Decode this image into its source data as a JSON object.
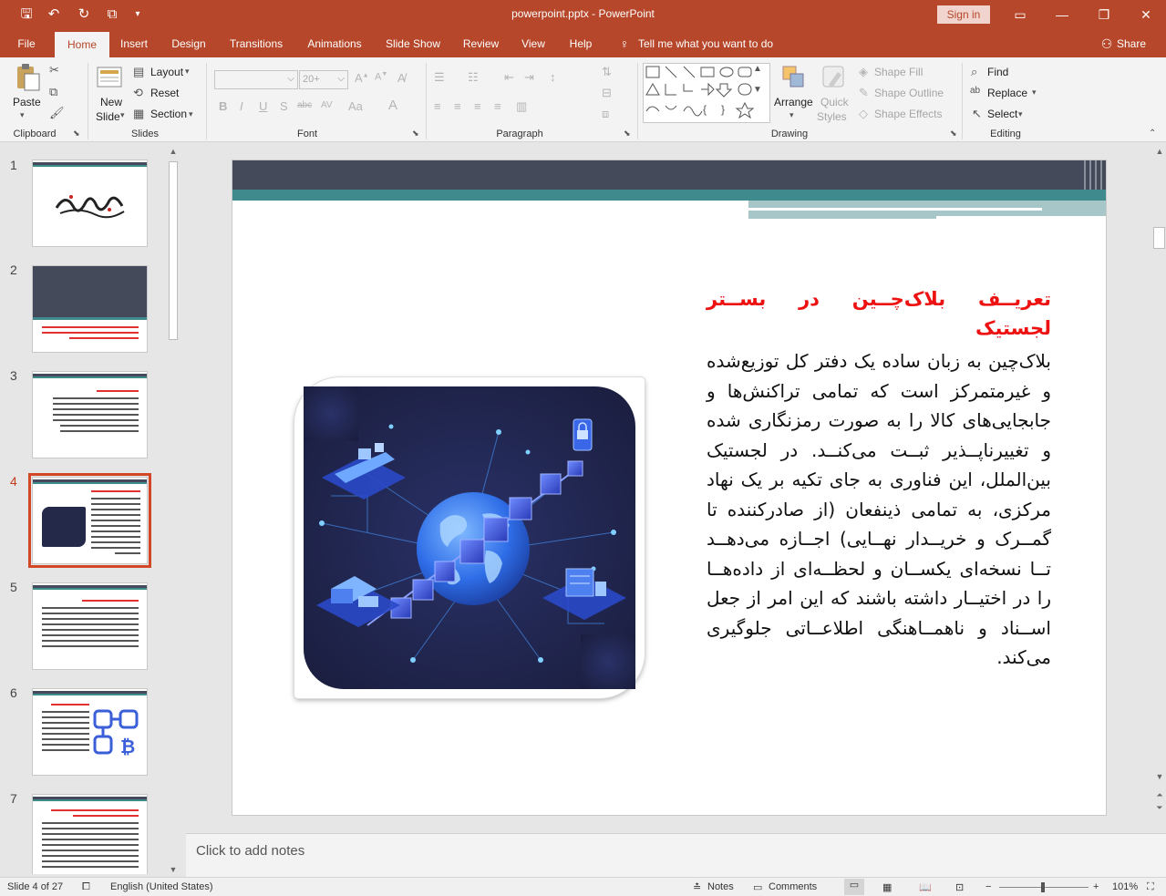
{
  "window": {
    "doc_title": "powerpoint.pptx  -  PowerPoint",
    "signin": "Sign in"
  },
  "tabs": [
    "File",
    "Home",
    "Insert",
    "Design",
    "Transitions",
    "Animations",
    "Slide Show",
    "Review",
    "View",
    "Help"
  ],
  "active_tab": "Home",
  "tell_me": "Tell me what you want to do",
  "share": "Share",
  "ribbon": {
    "clipboard": {
      "label": "Clipboard",
      "paste": "Paste"
    },
    "slides": {
      "label": "Slides",
      "new_slide_1": "New",
      "new_slide_2": "Slide",
      "layout": "Layout",
      "reset": "Reset",
      "section": "Section"
    },
    "font": {
      "label": "Font",
      "size_value": "20+"
    },
    "paragraph": {
      "label": "Paragraph"
    },
    "drawing": {
      "label": "Drawing",
      "arrange": "Arrange",
      "quick_styles_1": "Quick",
      "quick_styles_2": "Styles",
      "shape_fill": "Shape Fill",
      "shape_outline": "Shape Outline",
      "shape_effects": "Shape Effects"
    },
    "editing": {
      "label": "Editing",
      "find": "Find",
      "replace": "Replace",
      "select": "Select"
    }
  },
  "thumbnails": {
    "numbers": [
      "1",
      "2",
      "3",
      "4",
      "5",
      "6",
      "7"
    ],
    "current_index": 4
  },
  "slide": {
    "title": "تعریــف بلاک‌چــین در بســتر لجستیک",
    "body": "بلاک‌چین به زبان ساده یک دفتر کل توزیع‌شده و غیرمتمرکز است که تمامی تراکنش‌ها و جابجایی‌های کالا را به صورت رمزنگاری شده و تغییرناپــذیر ثبــت می‌کنــد. در لجستیک بین‌الملل، این فناوری به جای تکیه بر یک نهاد مرکزی، به تمامی ذینفعان (از صادرکننده تا گمــرک و خریــدار نهــایی) اجــازه می‌دهــد تــا نسخه‌ای یکســان و لحظــه‌ای از داده‌هــا را در اختیــار داشته باشند که این امر از جعل اســناد و ناهمــاهنگی اطلاعــاتی جلوگیری می‌کند."
  },
  "notes_placeholder": "Click to add notes",
  "status": {
    "slide_of": "Slide 4 of 27",
    "language": "English (United States)",
    "notes": "Notes",
    "comments": "Comments",
    "zoom": "101%"
  },
  "colors": {
    "accent": "#b7472a",
    "selected_thumb": "#d24726",
    "slide_header_dark": "#444a5a",
    "slide_header_teal": "#3f8a8c",
    "title_red": "#ee1111"
  }
}
